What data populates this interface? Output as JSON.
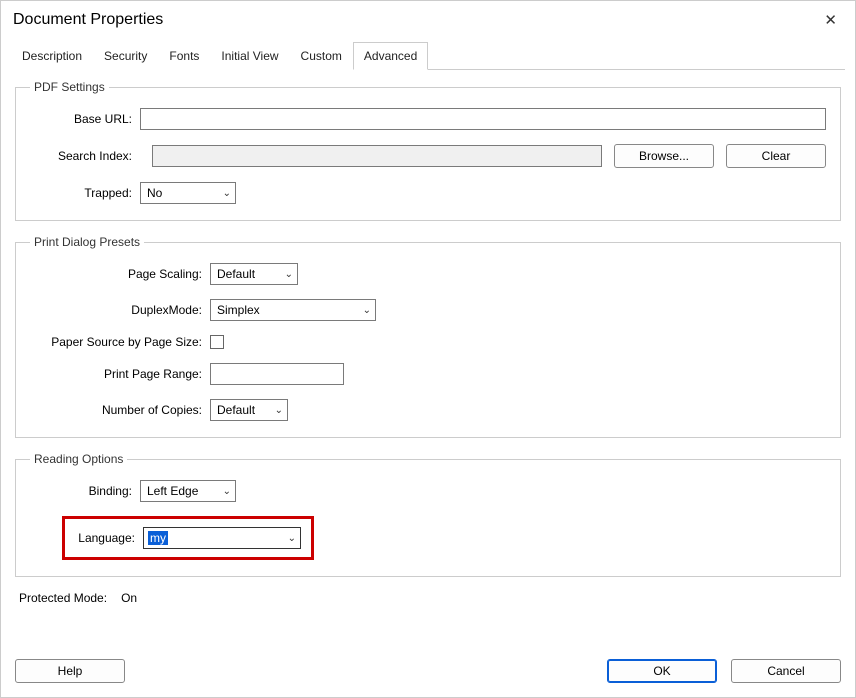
{
  "title": "Document Properties",
  "tabs": [
    "Description",
    "Security",
    "Fonts",
    "Initial View",
    "Custom",
    "Advanced"
  ],
  "active_tab": "Advanced",
  "pdf_settings": {
    "legend": "PDF Settings",
    "base_url_label": "Base URL:",
    "base_url_value": "",
    "search_index_label": "Search Index:",
    "browse_label": "Browse...",
    "clear_label": "Clear",
    "trapped_label": "Trapped:",
    "trapped_value": "No"
  },
  "print_presets": {
    "legend": "Print Dialog Presets",
    "page_scaling_label": "Page Scaling:",
    "page_scaling_value": "Default",
    "duplex_label": "DuplexMode:",
    "duplex_value": "Simplex",
    "paper_source_label": "Paper Source by Page Size:",
    "paper_source_checked": false,
    "print_range_label": "Print Page Range:",
    "print_range_value": "",
    "copies_label": "Number of Copies:",
    "copies_value": "Default"
  },
  "reading": {
    "legend": "Reading Options",
    "binding_label": "Binding:",
    "binding_value": "Left Edge",
    "language_label": "Language:",
    "language_value": "my"
  },
  "protected": {
    "label": "Protected Mode:",
    "value": "On"
  },
  "footer": {
    "help": "Help",
    "ok": "OK",
    "cancel": "Cancel"
  }
}
